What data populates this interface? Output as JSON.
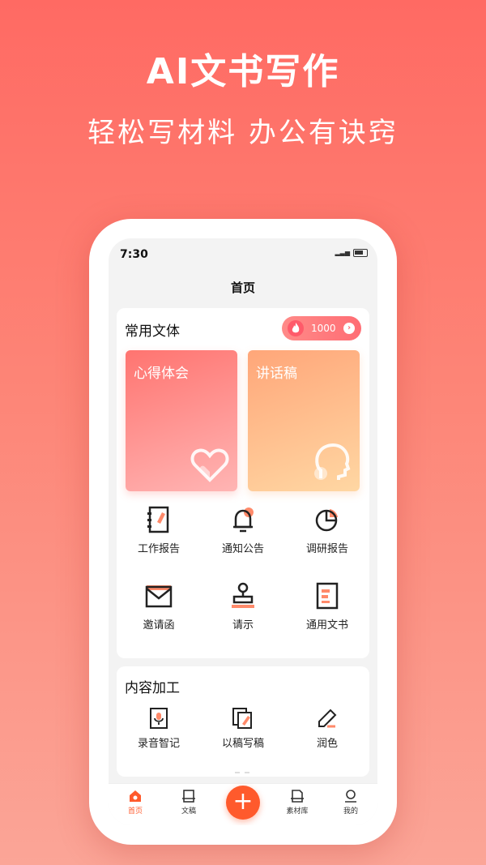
{
  "promo": {
    "title": "AI文书写作",
    "subtitle": "轻松写材料  办公有诀窍"
  },
  "status_bar": {
    "time": "7:30",
    "signal_icon": "signal-icon",
    "battery_icon": "battery-icon"
  },
  "nav": {
    "title": "首页"
  },
  "common_docs": {
    "title": "常用文体",
    "points": "1000",
    "points_icon": "flame-icon",
    "arrow": "›",
    "featured": [
      {
        "label": "心得体会",
        "icon": "heart-icon",
        "color": "#ff7470"
      },
      {
        "label": "讲话稿",
        "icon": "speaking-head-icon",
        "color": "#ffa679"
      }
    ],
    "types": [
      {
        "label": "工作报告",
        "icon": "notebook-icon"
      },
      {
        "label": "通知公告",
        "icon": "bell-icon"
      },
      {
        "label": "调研报告",
        "icon": "pie-chart-icon"
      },
      {
        "label": "邀请函",
        "icon": "envelope-icon"
      },
      {
        "label": "请示",
        "icon": "stamp-icon"
      },
      {
        "label": "通用文书",
        "icon": "document-icon"
      }
    ]
  },
  "content_processing": {
    "title": "内容加工",
    "tools": [
      {
        "label": "录音智记",
        "icon": "voice-recorder-icon"
      },
      {
        "label": "以稿写稿",
        "icon": "copy-edit-icon"
      },
      {
        "label": "润色",
        "icon": "brush-icon"
      }
    ]
  },
  "tab_bar": {
    "tabs": [
      {
        "label": "首页",
        "icon": "home-icon",
        "active": true
      },
      {
        "label": "文稿",
        "icon": "draft-icon",
        "active": false
      },
      {
        "label": "素材库",
        "icon": "library-icon",
        "active": false
      },
      {
        "label": "我的",
        "icon": "profile-icon",
        "active": false
      }
    ],
    "fab": "+"
  },
  "colors": {
    "accent": "#ff5a2c",
    "highlight": "#ff8a6a"
  }
}
